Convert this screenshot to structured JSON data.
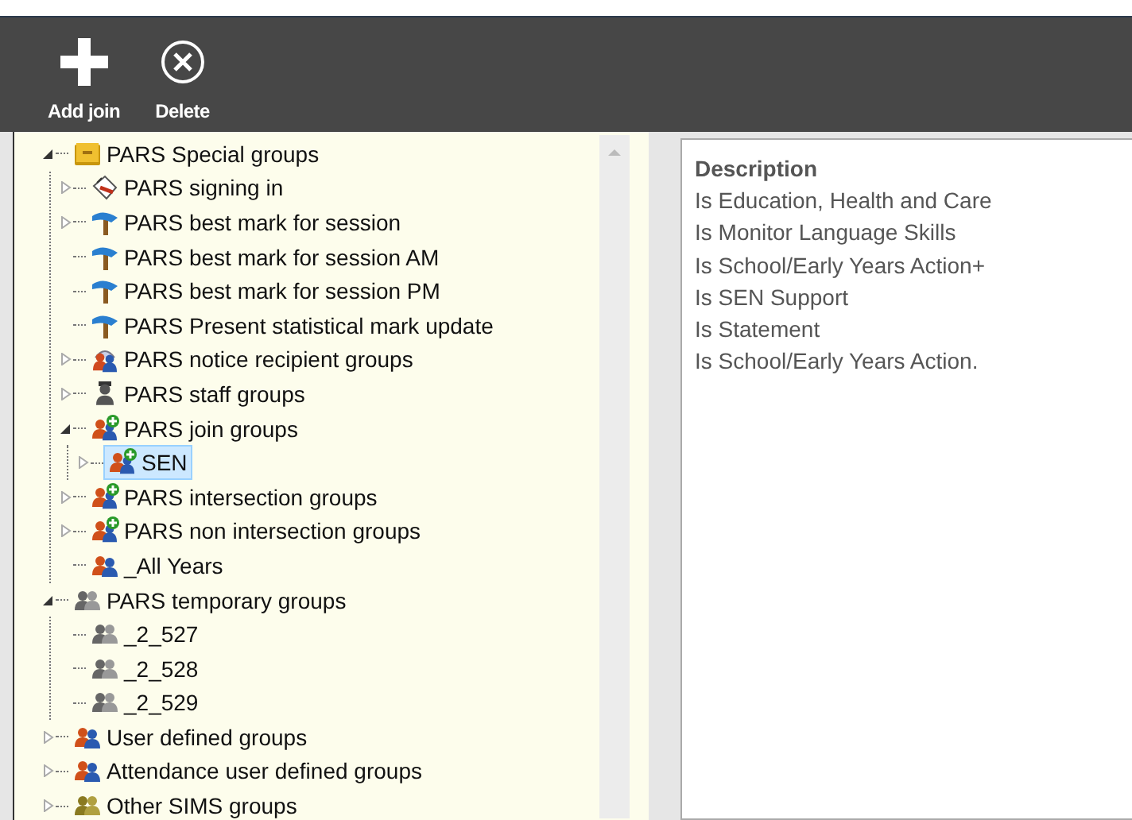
{
  "toolbar": [
    {
      "label": "Add join",
      "kind": "add"
    },
    {
      "label": "Delete",
      "kind": "delete"
    }
  ],
  "tree": [
    {
      "label": "PARS Special groups",
      "kind": "folder",
      "expanded": true,
      "selected": false,
      "children": [
        {
          "label": "PARS signing in",
          "kind": "signing",
          "expanded": false,
          "selected": false
        },
        {
          "label": "PARS best mark for session",
          "kind": "signpost",
          "expanded": false,
          "selected": false
        },
        {
          "label": "PARS best mark for session AM",
          "kind": "signpost",
          "selected": false
        },
        {
          "label": "PARS best mark for session PM",
          "kind": "signpost",
          "selected": false
        },
        {
          "label": "PARS Present statistical mark update",
          "kind": "signpost",
          "selected": false
        },
        {
          "label": "PARS notice recipient groups",
          "kind": "notice",
          "expanded": false,
          "selected": false
        },
        {
          "label": "PARS staff groups",
          "kind": "staff",
          "expanded": false,
          "selected": false
        },
        {
          "label": "PARS join groups",
          "kind": "join",
          "expanded": true,
          "selected": false,
          "children": [
            {
              "label": "SEN",
              "kind": "join",
              "expanded": false,
              "selected": true
            }
          ]
        },
        {
          "label": "PARS intersection groups",
          "kind": "join",
          "expanded": false,
          "selected": false
        },
        {
          "label": "PARS non intersection groups",
          "kind": "join",
          "expanded": false,
          "selected": false
        },
        {
          "label": "_All Years",
          "kind": "people",
          "selected": false
        }
      ]
    },
    {
      "label": "PARS temporary groups",
      "kind": "temp",
      "expanded": true,
      "selected": false,
      "children": [
        {
          "label": "_2_527",
          "kind": "temp",
          "selected": false
        },
        {
          "label": "_2_528",
          "kind": "temp",
          "selected": false
        },
        {
          "label": "_2_529",
          "kind": "temp",
          "selected": false
        }
      ]
    },
    {
      "label": "User defined groups",
      "kind": "people",
      "expanded": false,
      "selected": false
    },
    {
      "label": "Attendance user defined groups",
      "kind": "people",
      "expanded": false,
      "selected": false
    },
    {
      "label": "Other SIMS groups",
      "kind": "other",
      "expanded": false,
      "selected": false
    }
  ],
  "description": {
    "heading": "Description",
    "items": [
      "Is Education, Health and Care",
      "Is Monitor Language Skills",
      "Is School/Early Years Action+",
      "Is SEN Support",
      "Is Statement",
      "Is School/Early Years Action."
    ]
  }
}
